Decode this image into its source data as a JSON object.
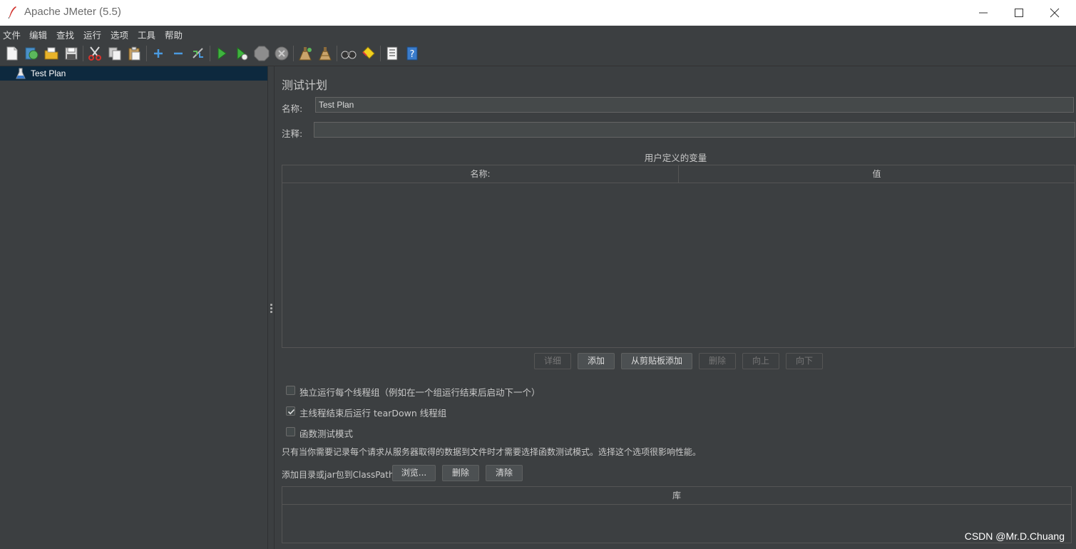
{
  "window": {
    "title": "Apache JMeter (5.5)"
  },
  "menu": [
    "文件",
    "编辑",
    "查找",
    "运行",
    "选项",
    "工具",
    "帮助"
  ],
  "toolbar": [
    "new-icon",
    "templates-icon",
    "open-icon",
    "save-icon",
    "cut-icon",
    "copy-icon",
    "paste-icon",
    "expand-icon",
    "collapse-icon",
    "toggle-icon",
    "start-icon",
    "start-no-pause-icon",
    "stop-icon",
    "shutdown-icon",
    "clear-icon",
    "clear-all-icon",
    "search-icon",
    "reset-search-icon",
    "function-helper-icon",
    "help-icon"
  ],
  "tree": {
    "items": [
      {
        "label": "Test Plan",
        "icon": "flask-icon"
      }
    ]
  },
  "panel": {
    "heading": "测试计划",
    "name_label": "名称:",
    "name_value": "Test Plan",
    "comment_label": "注释:",
    "comment_value": "",
    "udv_title": "用户定义的变量",
    "udv_columns": [
      "名称:",
      "值"
    ],
    "udv_buttons": [
      {
        "label": "详细",
        "enabled": false
      },
      {
        "label": "添加",
        "enabled": true
      },
      {
        "label": "从剪贴板添加",
        "enabled": true
      },
      {
        "label": "删除",
        "enabled": false
      },
      {
        "label": "向上",
        "enabled": false
      },
      {
        "label": "向下",
        "enabled": false
      }
    ],
    "options": [
      {
        "label": "独立运行每个线程组（例如在一个组运行结束后启动下一个）",
        "checked": false
      },
      {
        "label": "主线程结束后运行 tearDown 线程组",
        "checked": true
      },
      {
        "label": "函数测试模式",
        "checked": false
      }
    ],
    "functional_note": "只有当你需要记录每个请求从服务器取得的数据到文件时才需要选择函数测试模式。选择这个选项很影响性能。",
    "classpath_label": "添加目录或jar包到ClassPath",
    "classpath_buttons": [
      "浏览...",
      "删除",
      "清除"
    ],
    "library_column": "库"
  },
  "watermark": "CSDN @Mr.D.Chuang"
}
